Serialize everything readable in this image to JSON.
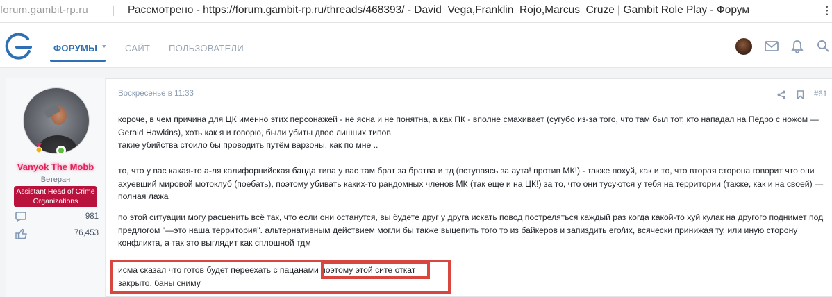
{
  "browser": {
    "url": "forum.gambit-rp.ru",
    "window_title": "Рассмотрено - https://forum.gambit-rp.ru/threads/468393/ - David_Vega,Franklin_Rojo,Marcus_Cruze | Gambit Role Play - Форум"
  },
  "nav": {
    "tabs": [
      {
        "label": "Форумы",
        "active": true
      },
      {
        "label": "Сайт",
        "active": false
      },
      {
        "label": "Пользователи",
        "active": false
      }
    ],
    "icons": [
      "moon-icon",
      "avatar",
      "mail-icon",
      "bell-icon",
      "search-icon"
    ],
    "accent_color": "#2f6fb3"
  },
  "post": {
    "author": {
      "name": "Vanyok The Mobb",
      "title": "Ветеран",
      "role": "Assistant Head of Crime Organizations",
      "name_color": "#e0245e",
      "role_color": "#b9123d",
      "messages": "981",
      "reactions": "76,453"
    },
    "date": "Воскресенье в 11:33",
    "number": "#61",
    "paragraphs": [
      "короче, в чем причина для ЦК именно этих персонажей - не ясна и не понятна, а как ПК - вполне смахивает (сугубо из-за того, что там был тот, кто нападал на Педро с ножом — Gerald Hawkins), хоть как я и говорю, были убиты двое лишних типов",
      "такие убийства стоило бы проводить путём варзоны, как по мне ..",
      "то, что у вас какая-то а-ля калифорнийская банда типа у вас там брат за братва и тд (вступаясь за аута! против МК!) - также похуй, как и то, что вторая сторона говорит что они ахуевший мировой мотоклуб (поебать), поэтому убивать каких-то рандомных членов МК (так еще и на ЦК!) за то, что они тусуются у тебя на территории (также, как и на своей) — полная лажа",
      "по этой ситуации могу расценить всё так, что если они останутся, вы будете друг у друга искать повод постреляться каждый раз когда какой-то хуй кулак на другого поднимет под предлогом \"—это наша территория\". альтернативным действием могли бы также выцепить того то из байкеров и запиздить его/их, всячески принижая ту, или иную сторону конфликта, а так это выглядит как сплошной тдм"
    ],
    "final_line_1_a": "исма сказал что готов будет переехать с пацанами",
    "final_line_1_b": "поэтому этой сите откат",
    "final_line_2": "закрыто, баны сниму",
    "highlight_color": "#d7473f"
  }
}
